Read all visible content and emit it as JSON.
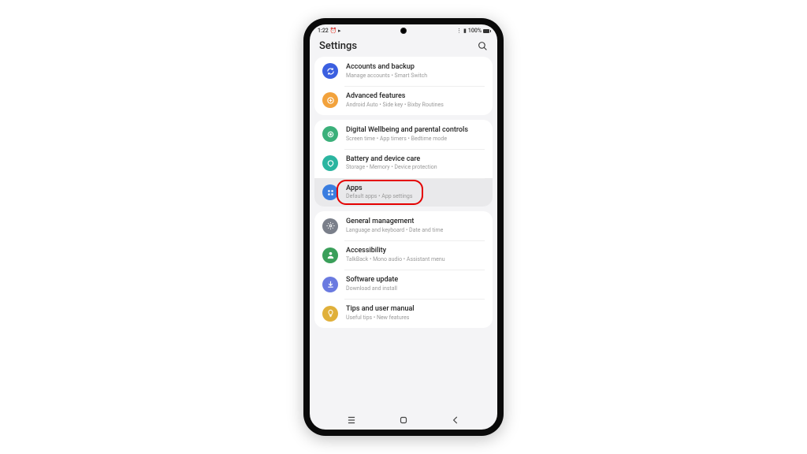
{
  "statusbar": {
    "time": "1:22",
    "battery": "100%"
  },
  "header": {
    "title": "Settings"
  },
  "groups": [
    {
      "items": [
        {
          "id": "accounts",
          "title": "Accounts and backup",
          "sub": "Manage accounts • Smart Switch",
          "color": "#3b5fe0",
          "icon": "sync"
        },
        {
          "id": "advanced",
          "title": "Advanced features",
          "sub": "Android Auto • Side key • Bixby Routines",
          "color": "#f2a23c",
          "icon": "plus"
        }
      ]
    },
    {
      "items": [
        {
          "id": "wellbeing",
          "title": "Digital Wellbeing and parental controls",
          "sub": "Screen time • App timers • Bedtime mode",
          "color": "#3bb07a",
          "icon": "circle"
        },
        {
          "id": "battery",
          "title": "Battery and device care",
          "sub": "Storage • Memory • Device protection",
          "color": "#2bb5a0",
          "icon": "care"
        },
        {
          "id": "apps",
          "title": "Apps",
          "sub": "Default apps • App settings",
          "color": "#3a7de0",
          "icon": "grid",
          "highlight": true
        }
      ]
    },
    {
      "items": [
        {
          "id": "general",
          "title": "General management",
          "sub": "Language and keyboard • Date and time",
          "color": "#7a7f8a",
          "icon": "gear"
        },
        {
          "id": "accessibility",
          "title": "Accessibility",
          "sub": "TalkBack • Mono audio • Assistant menu",
          "color": "#3a9f5a",
          "icon": "person"
        },
        {
          "id": "software",
          "title": "Software update",
          "sub": "Download and install",
          "color": "#6a7ae0",
          "icon": "download"
        },
        {
          "id": "tips",
          "title": "Tips and user manual",
          "sub": "Useful tips • New features",
          "color": "#e0b03a",
          "icon": "bulb"
        }
      ]
    }
  ],
  "annotation": {
    "target": "apps"
  }
}
